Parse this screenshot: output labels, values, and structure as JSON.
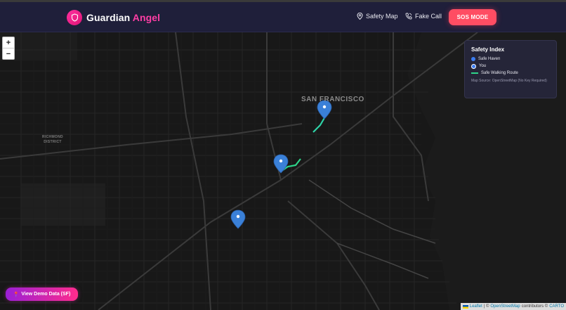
{
  "app": {
    "brand_part1": "Guardian",
    "brand_part2": "Angel"
  },
  "nav": {
    "safety_map_label": "Safety Map",
    "fake_call_label": "Fake Call",
    "sos_label": "SOS MODE"
  },
  "map": {
    "city_label": "SAN FRANCISCO",
    "district_label": "RICHMOND DISTRICT",
    "zoom_in": "+",
    "zoom_out": "−"
  },
  "legend": {
    "title": "Safety Index",
    "safe_haven": "Safe Haven",
    "you": "You",
    "route": "Safe Walking Route",
    "source": "Map Source: OpenStreetMap (No Key Required)"
  },
  "demo": {
    "label": "View Demo Data (SF)"
  },
  "attribution": {
    "leaflet": "Leaflet",
    "separator": "| ©",
    "osm": "OpenStreetMap",
    "contributors": "contributors ©",
    "carto": "CARTO"
  },
  "colors": {
    "brand_pink": "#ff3ea5",
    "sos_red": "#ff4d63",
    "marker_blue": "#3a7bf0",
    "route_green": "#2ed48a",
    "navbar_bg": "#1f1f3a"
  },
  "icons": {
    "logo": "shield-icon",
    "safety_map": "map-pin-icon",
    "fake_call": "phone-icon",
    "demo": "pin-icon"
  }
}
